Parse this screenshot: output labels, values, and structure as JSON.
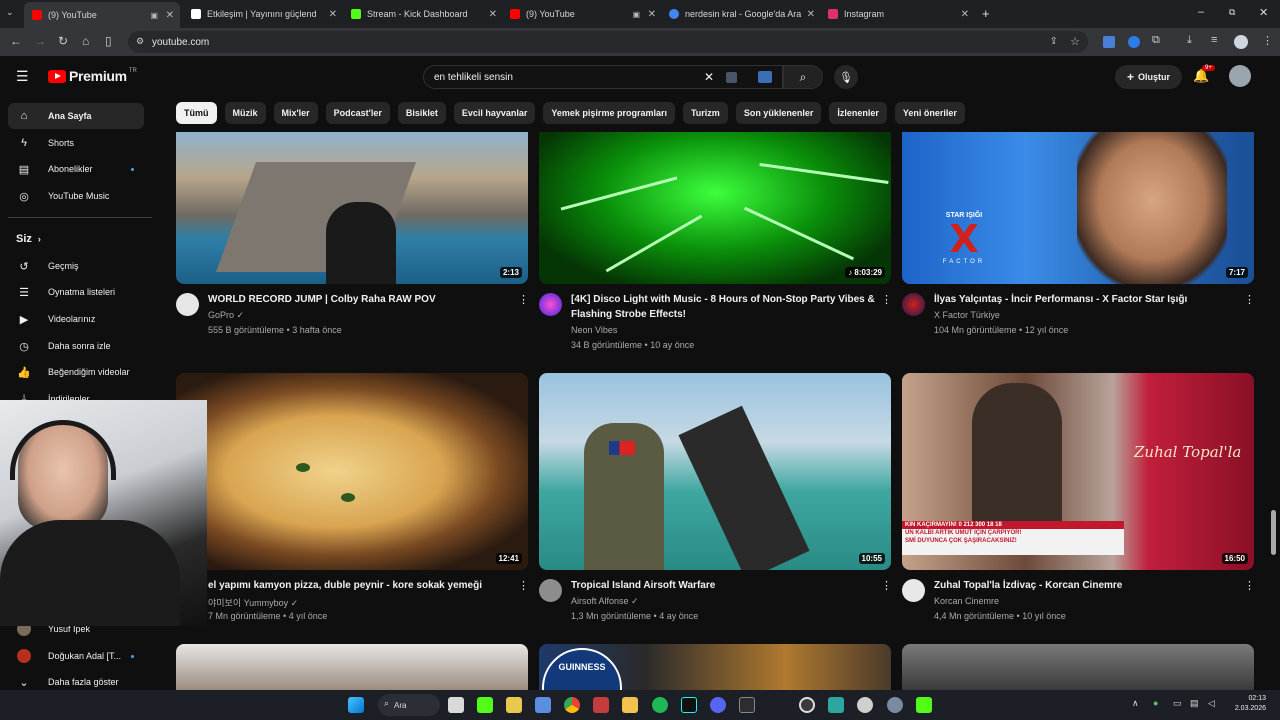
{
  "browser": {
    "tabs": [
      {
        "title": "(9) YouTube",
        "color": "#ff0000"
      },
      {
        "title": "Etkileşim | Yayınını güçlendirme",
        "color": "#ffffff"
      },
      {
        "title": "Stream - Kick Dashboard",
        "color": "#53fc18"
      },
      {
        "title": "(9) YouTube",
        "color": "#ff0000"
      },
      {
        "title": "nerdesin kral - Google'da Ara",
        "color": "#4285f4"
      },
      {
        "title": "Instagram",
        "color": "#e1306c"
      }
    ],
    "url": "youtube.com"
  },
  "header": {
    "logo_word": "Premium",
    "logo_region": "TR",
    "search_value": "en tehlikeli sensin",
    "create_label": "Oluştur",
    "notification_badge": "9+"
  },
  "chips": [
    "Tümü",
    "Müzik",
    "Mix'ler",
    "Podcast'ler",
    "Bisiklet",
    "Evcil hayvanlar",
    "Yemek pişirme programları",
    "Turizm",
    "Son yüklenenler",
    "İzlenenler",
    "Yeni öneriler"
  ],
  "sidebar": {
    "main": [
      {
        "label": "Ana Sayfa",
        "icon": "home-icon"
      },
      {
        "label": "Shorts",
        "icon": "shorts-icon"
      },
      {
        "label": "Abonelikler",
        "icon": "subscriptions-icon"
      },
      {
        "label": "YouTube Music",
        "icon": "music-icon"
      }
    ],
    "you_header": "Siz",
    "you": [
      {
        "label": "Geçmiş",
        "icon": "history-icon"
      },
      {
        "label": "Oynatma listeleri",
        "icon": "playlists-icon"
      },
      {
        "label": "Videolarınız",
        "icon": "your-videos-icon"
      },
      {
        "label": "Daha sonra izle",
        "icon": "watch-later-icon"
      },
      {
        "label": "Beğendiğim videolar",
        "icon": "liked-icon"
      },
      {
        "label": "İndirilenler",
        "icon": "downloads-icon"
      }
    ],
    "subs": [
      {
        "label": "Yusuf İpek"
      },
      {
        "label": "Doğukan Adal [T..."
      }
    ],
    "show_more": "Daha fazla göster"
  },
  "videos": [
    {
      "title": "WORLD RECORD JUMP | Colby Raha RAW POV",
      "title2": "",
      "channel": "GoPro",
      "verified": true,
      "meta": "555 B görüntüleme • 3 hafta önce",
      "duration": "2:13"
    },
    {
      "title": "[4K] Disco Light with Music - 8 Hours of Non-Stop Party Vibes &",
      "title2": "Flashing Strobe Effects!",
      "channel": "Neon Vibes",
      "verified": false,
      "meta": "34 B görüntüleme • 10 ay önce",
      "duration": "♪ 8:03:29"
    },
    {
      "title": "İlyas Yalçıntaş - İncir Performansı - X Factor Star Işığı",
      "title2": "",
      "channel": "X Factor Türkiye",
      "verified": false,
      "meta": "104 Mn görüntüleme • 12 yıl önce",
      "duration": "7:17"
    },
    {
      "title": "el yapımı kamyon pizza, duble peynir - kore sokak yemeği",
      "title2": "",
      "channel": "야미보이 Yummyboy",
      "verified": true,
      "meta": "7 Mn görüntüleme • 4 yıl önce",
      "duration": "12:41"
    },
    {
      "title": "Tropical Island Airsoft Warfare",
      "title2": "",
      "channel": "Airsoft Alfonse",
      "verified": true,
      "meta": "1,3 Mn görüntüleme • 4 ay önce",
      "duration": "10:55"
    },
    {
      "title": "Zuhal Topal'la İzdivaç - Korcan Cinemre",
      "title2": "",
      "channel": "Korcan Cinemre",
      "verified": false,
      "meta": "4,4 Mn görüntüleme • 10 yıl önce",
      "duration": "16:50"
    }
  ],
  "thumb_text": {
    "xfactor": "STAR IŞIĞI",
    "xfactor_sub": "FACTOR",
    "zuhal": "Zuhal Topal'la",
    "ticker1": "KIN KAÇIRMAYIN!          0 212 300 18 18",
    "ticker2": "UN KALBİ ARTIK UMUT İÇİN ÇARPIYOR!",
    "ticker3": "SMİ DUYUNCA ÇOK ŞAŞIRACAKSINIZ!",
    "guinness": "GUINNESS"
  },
  "taskbar": {
    "search_label": "Ara",
    "time": "02:13",
    "date": "2.03.2026"
  }
}
